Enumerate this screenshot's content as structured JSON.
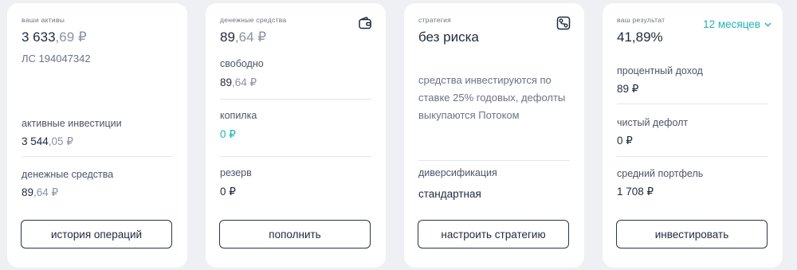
{
  "assets": {
    "caption": "ваши активы",
    "total_int": "3 633",
    "total_frac": ",69 ₽",
    "account": "ЛС 194047342",
    "active_label": "активные инвестиции",
    "active_int": "3 544",
    "active_frac": ",05 ₽",
    "cash_label": "денежные средства",
    "cash_int": "89",
    "cash_frac": ",64 ₽",
    "button": "история операций"
  },
  "cash": {
    "caption": "денежные средства",
    "total_int": "89",
    "total_frac": ",64 ₽",
    "free_label": "свободно",
    "free_int": "89",
    "free_frac": ",64 ₽",
    "piggy_label": "копилка",
    "piggy_value": "0 ₽",
    "reserve_label": "резерв",
    "reserve_value": "0 ₽",
    "button": "пополнить",
    "icon": "wallet-icon"
  },
  "strategy": {
    "caption": "стратегия",
    "name": "без риска",
    "description": "средства инвестируются по ставке 25% годовых, дефолты выкупаются Потоком",
    "div_label": "диверсификация",
    "div_value": "стандартная",
    "button": "настроить стратегию",
    "icon": "strategy-icon"
  },
  "result": {
    "caption": "ваш результат",
    "value": "41,89%",
    "period": "12 месяцев",
    "interest_label": "процентный доход",
    "interest_value": "89 ₽",
    "default_label": "чистый дефолт",
    "default_value": "0 ₽",
    "portfolio_label": "средний портфель",
    "portfolio_value": "1 708 ₽",
    "button": "инвестировать"
  },
  "colors": {
    "accent": "#21b3b3",
    "text": "#1f2a3d",
    "muted": "#6b7385",
    "background": "#eef0f3"
  }
}
